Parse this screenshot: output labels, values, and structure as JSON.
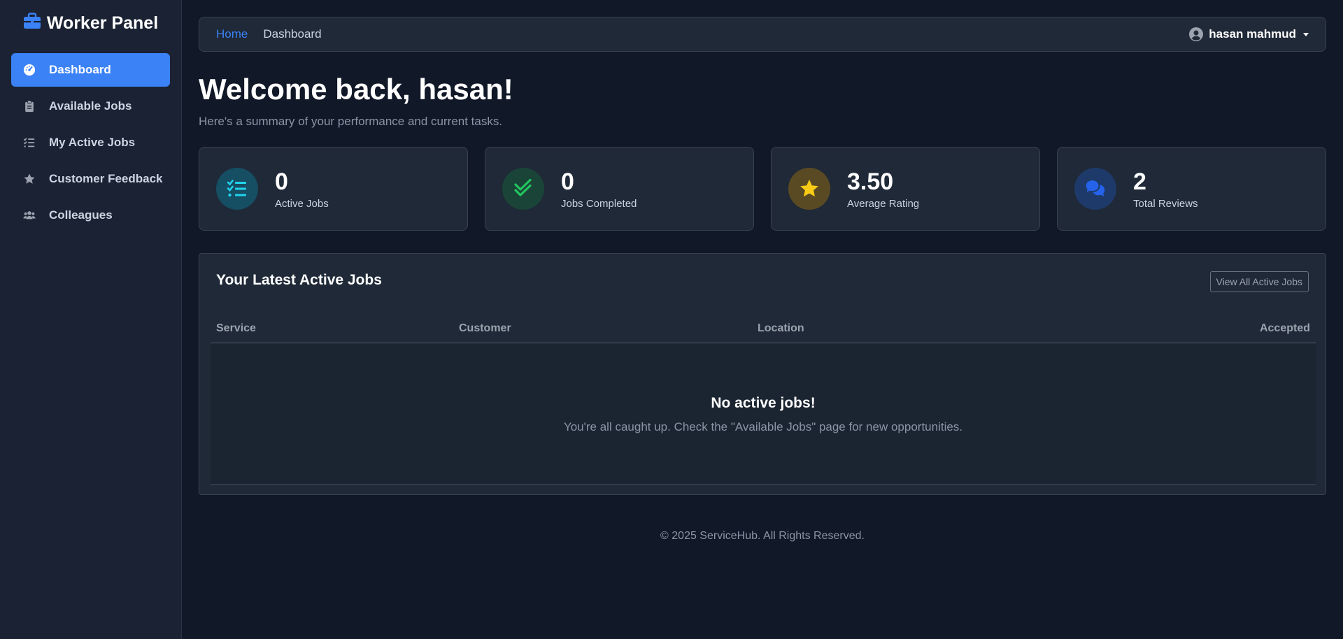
{
  "app": {
    "title": "Worker Panel"
  },
  "sidebar": {
    "items": [
      {
        "label": "Dashboard",
        "icon": "gauge-icon",
        "active": true
      },
      {
        "label": "Available Jobs",
        "icon": "clipboard-icon",
        "active": false
      },
      {
        "label": "My Active Jobs",
        "icon": "list-check-icon",
        "active": false
      },
      {
        "label": "Customer Feedback",
        "icon": "star-icon",
        "active": false
      },
      {
        "label": "Colleagues",
        "icon": "users-icon",
        "active": false
      }
    ]
  },
  "header": {
    "breadcrumb": [
      "Home",
      "Dashboard"
    ],
    "user": "hasan mahmud"
  },
  "welcome": {
    "title": "Welcome back, hasan!",
    "subtitle": "Here's a summary of your performance and current tasks."
  },
  "stats": [
    {
      "value": "0",
      "label": "Active Jobs",
      "icon": "list-check-icon",
      "color": "#22d3ee",
      "bg": "#164e63"
    },
    {
      "value": "0",
      "label": "Jobs Completed",
      "icon": "double-check-icon",
      "color": "#22c55e",
      "bg": "#1a4438"
    },
    {
      "value": "3.50",
      "label": "Average Rating",
      "icon": "star-icon",
      "color": "#facc15",
      "bg": "#5a4a24"
    },
    {
      "value": "2",
      "label": "Total Reviews",
      "icon": "comments-icon",
      "color": "#2563eb",
      "bg": "#1e3a6a"
    }
  ],
  "jobs": {
    "title": "Your Latest Active Jobs",
    "view_all": "View All Active Jobs",
    "columns": [
      "Service",
      "Customer",
      "Location",
      "Accepted"
    ],
    "empty_title": "No active jobs!",
    "empty_text": "You're all caught up. Check the \"Available Jobs\" page for new opportunities."
  },
  "footer": {
    "text": "© 2025 ServiceHub. All Rights Reserved."
  },
  "colors": {
    "accent": "#3b82f6",
    "background": "#111827",
    "card": "#1f2937"
  }
}
